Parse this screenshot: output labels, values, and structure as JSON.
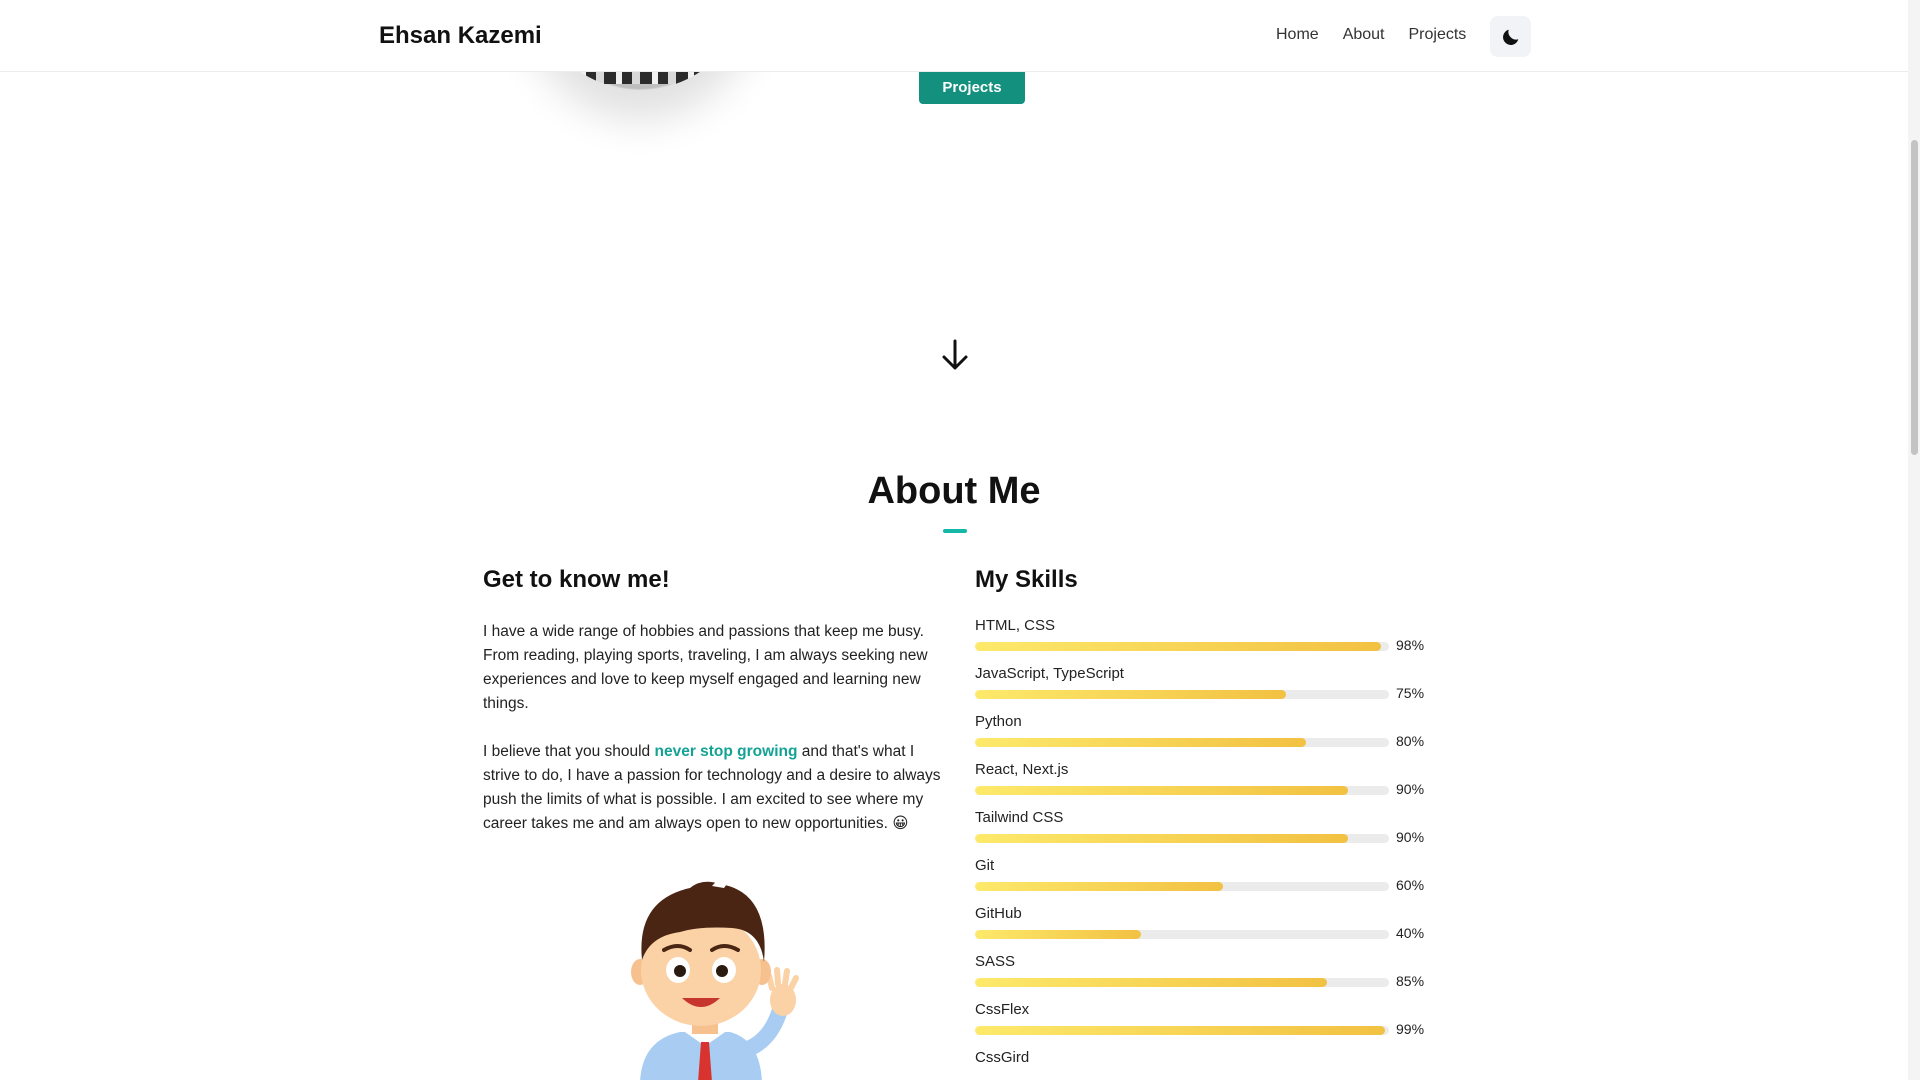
{
  "header": {
    "brand": "Ehsan Kazemi",
    "nav": [
      "Home",
      "About",
      "Projects"
    ],
    "theme_icon": "moon-icon"
  },
  "hero": {
    "projects_button": "Projects",
    "scroll_icon": "arrow-down-icon"
  },
  "about": {
    "title": "About Me",
    "accent_color": "#14b8a6",
    "left": {
      "heading": "Get to know me!",
      "para1": "I have a wide range of hobbies and passions that keep me busy. From reading, playing sports, traveling, I am always seeking new experiences and love to keep myself engaged and learning new things.",
      "para2_before": "I believe that you should ",
      "para2_highlight": "never stop growing",
      "para2_after": " and that's what I strive to do, I have a passion for technology and a desire to always push the limits of what is possible. I am excited to see where my career takes me and am always open to new opportunities. 😀"
    },
    "right": {
      "heading": "My Skills",
      "skills": [
        {
          "name": "HTML, CSS",
          "percent": 98,
          "label": "98%"
        },
        {
          "name": "JavaScript, TypeScript",
          "percent": 75,
          "label": "75%"
        },
        {
          "name": "Python",
          "percent": 80,
          "label": "80%"
        },
        {
          "name": "React, Next.js",
          "percent": 90,
          "label": "90%"
        },
        {
          "name": "Tailwind CSS",
          "percent": 90,
          "label": "90%"
        },
        {
          "name": "Git",
          "percent": 60,
          "label": "60%"
        },
        {
          "name": "GitHub",
          "percent": 40,
          "label": "40%"
        },
        {
          "name": "SASS",
          "percent": 85,
          "label": "85%"
        },
        {
          "name": "CssFlex",
          "percent": 99,
          "label": "99%"
        },
        {
          "name": "CssGird",
          "percent": null,
          "label": ""
        }
      ]
    }
  },
  "colors": {
    "button_bg": "#14907f",
    "highlight": "#14a295",
    "bar_start": "#fde96b",
    "bar_end": "#f2c142"
  }
}
